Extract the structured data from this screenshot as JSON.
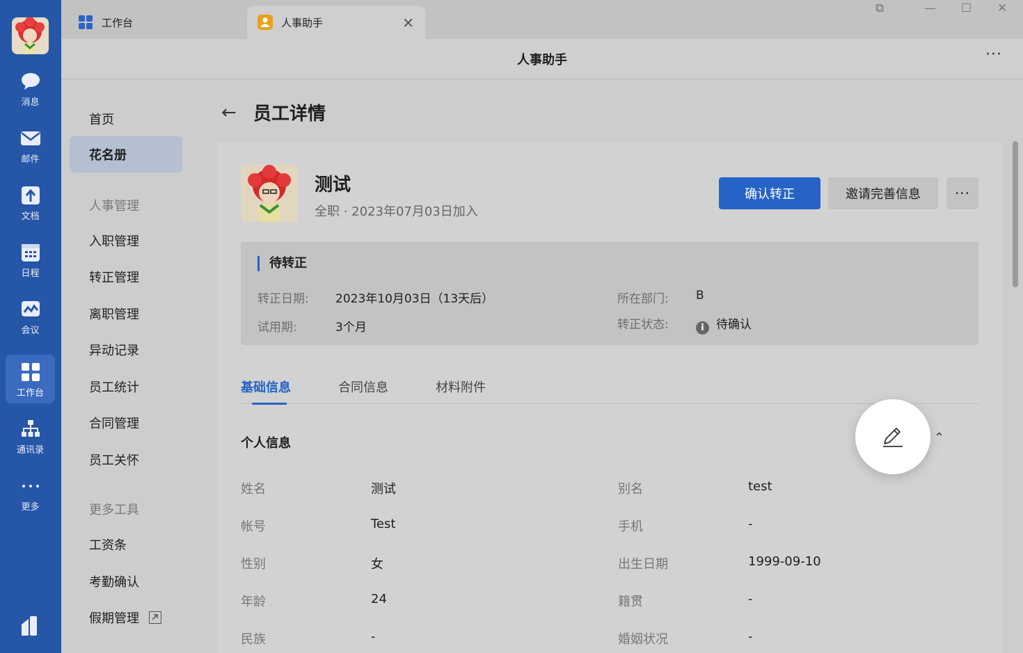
{
  "rail": {
    "items": [
      {
        "label": "消息",
        "icon": "chat-bubble-icon"
      },
      {
        "label": "邮件",
        "icon": "mail-icon"
      },
      {
        "label": "文档",
        "icon": "document-icon"
      },
      {
        "label": "日程",
        "icon": "calendar-icon"
      },
      {
        "label": "会议",
        "icon": "meeting-icon"
      },
      {
        "label": "工作台",
        "icon": "workbench-grid-icon",
        "active": true
      },
      {
        "label": "通讯录",
        "icon": "org-chart-icon"
      },
      {
        "label": "更多",
        "icon": "more-dots-icon"
      }
    ]
  },
  "tabs": {
    "workbench": "工作台",
    "hr_assistant": "人事助手",
    "close_glyph": "✕"
  },
  "window": {
    "restore_glyph": "⧉",
    "minimize_glyph": "—",
    "maximize_glyph": "☐",
    "close_glyph": "✕"
  },
  "titlebar": {
    "title": "人事助手",
    "more": "···"
  },
  "nav": {
    "home": "首页",
    "roster": "花名册",
    "hr_section": "人事管理",
    "onboarding": "入职管理",
    "regularization": "转正管理",
    "offboarding": "离职管理",
    "changes": "异动记录",
    "stats": "员工统计",
    "contracts": "合同管理",
    "care": "员工关怀",
    "tools_section": "更多工具",
    "payslip": "工资条",
    "attendance": "考勤确认",
    "leave": "假期管理"
  },
  "page": {
    "back": "←",
    "title": "员工详情"
  },
  "employee": {
    "name": "测试",
    "subtitle": "全职 · 2023年07月03日加入"
  },
  "actions": {
    "confirm": "确认转正",
    "invite": "邀请完善信息",
    "more": "···"
  },
  "status": {
    "title": "待转正",
    "date_label": "转正日期:",
    "date_value": "2023年10月03日（13天后）",
    "probation_label": "试用期:",
    "probation_value": "3个月",
    "dept_label": "所在部门:",
    "dept_value": "B",
    "state_label": "转正状态:",
    "state_icon": "i",
    "state_value": "待确认"
  },
  "detail_tabs": {
    "basic": "基础信息",
    "contract": "合同信息",
    "attachments": "材料附件"
  },
  "section": {
    "personal": "个人信息",
    "collapse": "⌃"
  },
  "fields": {
    "left": [
      {
        "label": "姓名",
        "value": "测试"
      },
      {
        "label": "帐号",
        "value": "Test"
      },
      {
        "label": "性别",
        "value": "女"
      },
      {
        "label": "年龄",
        "value": "24"
      },
      {
        "label": "民族",
        "value": "-"
      }
    ],
    "right": [
      {
        "label": "别名",
        "value": "test"
      },
      {
        "label": "手机",
        "value": "-"
      },
      {
        "label": "出生日期",
        "value": "1999-09-10"
      },
      {
        "label": "籍贯",
        "value": "-"
      },
      {
        "label": "婚姻状况",
        "value": "-"
      }
    ]
  },
  "colors": {
    "rail": "#2656a8",
    "accent": "#2563c7"
  }
}
